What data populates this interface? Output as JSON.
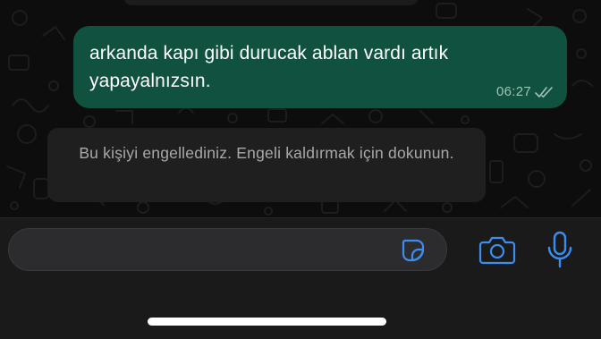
{
  "chat": {
    "outgoing_message": {
      "text": "arkanda kapı gibi durucak ablan vardı artık yapayalnızsın.",
      "time": "06:27",
      "status_icon": "double-check-icon"
    },
    "system_notice": {
      "text": "Bu kişiyi engellediniz. Engeli kaldırmak için dokunun."
    }
  },
  "input_bar": {
    "message_value": "",
    "sticker_icon": "sticker-icon",
    "camera_icon": "camera-icon",
    "mic_icon": "microphone-icon",
    "accent_color": "#3b8df0"
  },
  "colors": {
    "outgoing_bubble": "#10523f",
    "system_bubble": "#1f1f20",
    "background": "#0d0d0d"
  }
}
